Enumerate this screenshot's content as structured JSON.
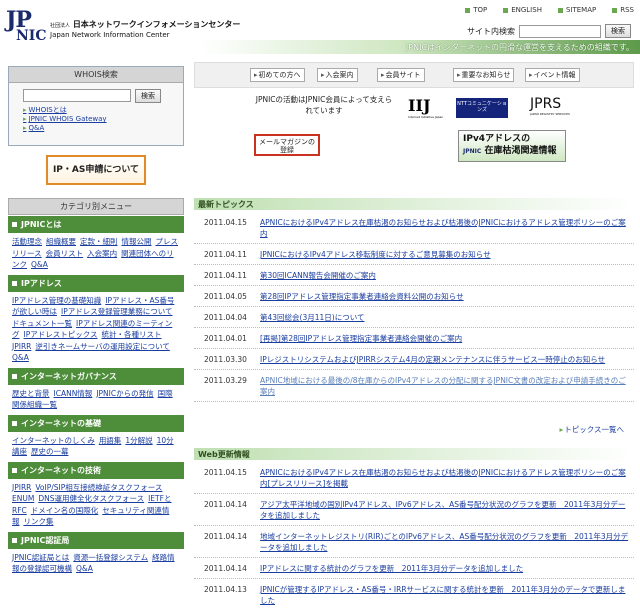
{
  "header": {
    "logo_top": "JP",
    "logo_bottom": "NIC",
    "org_prefix": "社団法人",
    "org_name_jp": "日本ネットワークインフォメーションセンター",
    "org_name_en": "Japan Network Information Center",
    "nav": [
      "TOP",
      "ENGLISH",
      "SITEMAP",
      "RSS"
    ],
    "search_label": "サイト内検索",
    "search_value": "",
    "search_button": "検索",
    "tagline": "JPNICはインターネットの円滑な運営を支えるための組織です。"
  },
  "whois": {
    "title": "WHOIS検索",
    "input_value": "",
    "button": "検索",
    "links": [
      "WHOISとは",
      "JPNIC WHOIS Gateway",
      "Q&A"
    ]
  },
  "ipas_banner": "IP・AS申請について",
  "category": {
    "title": "カテゴリ別メニュー",
    "sections": [
      {
        "name": "JPNICとは",
        "links": [
          "活動理念",
          "組織概要",
          "定款・細則",
          "情報公開",
          "プレスリリース",
          "会員リスト",
          "入会案内",
          "関連団体へのリンク",
          "Q&A"
        ]
      },
      {
        "name": "IPアドレス",
        "links": [
          "IPアドレス管理の基礎知識",
          "IPアドレス・AS番号が欲しい時は",
          "IPアドレス登録管理業務について",
          "ドキュメント一覧",
          "IPアドレス関連のミーティング",
          "IPアドレストピックス",
          "統計・各種リスト",
          "JPIRR",
          "逆引きネームサーバの運用設定について",
          "Q&A"
        ]
      },
      {
        "name": "インターネットガバナンス",
        "links": [
          "歴史と背景",
          "ICANN情報",
          "JPNICからの発信",
          "国際関係組織一覧"
        ]
      },
      {
        "name": "インターネットの基礎",
        "links": [
          "インターネットのしくみ",
          "用語集",
          "1分解説",
          "10分講座",
          "歴史の一幕"
        ]
      },
      {
        "name": "インターネットの技術",
        "links": [
          "JPIRR",
          "VoIP/SIP相互接続検証タスクフォース",
          "ENUM",
          "DNS運用健全化タスクフォース",
          "IETFとRFC",
          "ドメイン名の国際化",
          "セキュリティ関連情報",
          "リンク集"
        ]
      },
      {
        "name": "JPNIC認証局",
        "links": [
          "JPNIC認証局とは",
          "資源一括登録システム",
          "経路情報の登録認可機構",
          "Q&A"
        ]
      }
    ]
  },
  "quicklinks": [
    "初めての方へ",
    "入会案内",
    "会員サイト",
    "重要なお知らせ",
    "イベント情報"
  ],
  "sponsor_text": "JPNICの活動はJPNIC会員によって支えられています",
  "sponsors": {
    "iij": "IIJ",
    "iij_sub": "Internet Initiative Japan",
    "ntt": "NTTコミュニケーションズ",
    "jprs": "JPRS",
    "jprs_sub": "JAPAN REGISTRY SERVICES"
  },
  "mail_banner": "メールマガジンの登録",
  "ipv4_banner": {
    "line1": "IPv4アドレスの",
    "line2": "在庫枯渇関連情報",
    "badge": "JPNIC"
  },
  "latest": {
    "title": "最新トピックス",
    "items": [
      {
        "date": "2011.04.15",
        "text": "APNICにおけるIPv4アドレス在庫枯渇のお知らせおよび枯渇後のJPNICにおけるアドレス管理ポリシーのご案内"
      },
      {
        "date": "2011.04.11",
        "text": "JPNICにおけるIPv4アドレス移転制度に対するご意見募集のお知らせ"
      },
      {
        "date": "2011.04.11",
        "text": "第30回ICANN報告会開催のご案内"
      },
      {
        "date": "2011.04.05",
        "text": "第28回IPアドレス管理指定事業者連絡会資料公開のお知らせ"
      },
      {
        "date": "2011.04.04",
        "text": "第43回総会(3月11日)について"
      },
      {
        "date": "2011.04.01",
        "text": "[再掲]第28回IPアドレス管理指定事業者連絡会開催のご案内"
      },
      {
        "date": "2011.03.30",
        "text": "IPレジストリシステムおよびJPIRRシステム4月の定期メンテナンスに伴うサービス一時停止のお知らせ"
      },
      {
        "date": "2011.03.29",
        "text": "APNIC地域における最後の/8在庫からのIPv4アドレスの分配に関するJPNIC文書の改定および申請手続きのご案内"
      }
    ],
    "more": "トピックス一覧へ"
  },
  "web_updates": {
    "title": "Web更新情報",
    "items": [
      {
        "date": "2011.04.15",
        "text": "APNICにおけるIPv4アドレス在庫枯渇のお知らせおよび枯渇後のJPNICにおけるアドレス管理ポリシーのご案内[プレスリリース]を掲載"
      },
      {
        "date": "2011.04.14",
        "text": "アジア太平洋地域の国別IPv4アドレス、IPv6アドレス、AS番号配分状況のグラフを更新　2011年3月分データを追加しました"
      },
      {
        "date": "2011.04.14",
        "text": "地域インターネットレジストリ(RIR)ごとのIPv6アドレス、AS番号配分状況のグラフを更新　2011年3月分データを追加しました"
      },
      {
        "date": "2011.04.14",
        "text": "IPアドレスに関する統計のグラフを更新　2011年3月分データを追加しました"
      },
      {
        "date": "2011.04.13",
        "text": "JPNICが管理するIPアドレス・AS番号・IRRサービスに関する統計を更新　2011年3月分のデータで更新しました"
      }
    ]
  }
}
